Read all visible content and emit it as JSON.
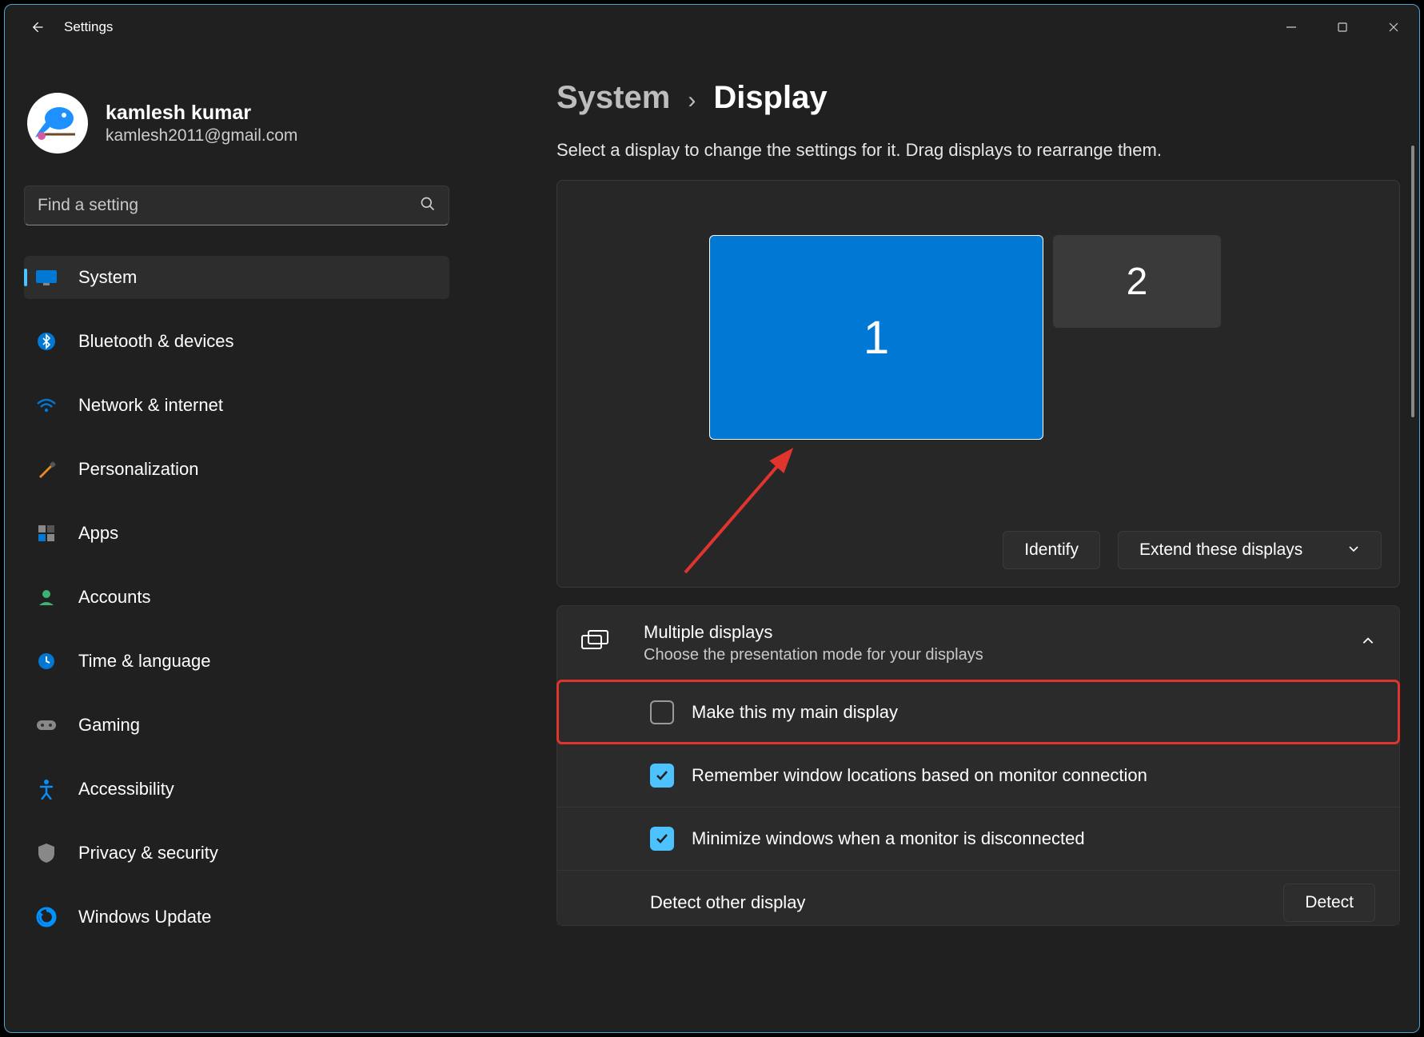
{
  "titlebar": {
    "app_name": "Settings"
  },
  "profile": {
    "name": "kamlesh kumar",
    "email": "kamlesh2011@gmail.com"
  },
  "search": {
    "placeholder": "Find a setting"
  },
  "nav": [
    {
      "label": "System",
      "active": true
    },
    {
      "label": "Bluetooth & devices"
    },
    {
      "label": "Network & internet"
    },
    {
      "label": "Personalization"
    },
    {
      "label": "Apps"
    },
    {
      "label": "Accounts"
    },
    {
      "label": "Time & language"
    },
    {
      "label": "Gaming"
    },
    {
      "label": "Accessibility"
    },
    {
      "label": "Privacy & security"
    },
    {
      "label": "Windows Update"
    }
  ],
  "breadcrumb": {
    "parent": "System",
    "current": "Display"
  },
  "hint": "Select a display to change the settings for it. Drag displays to rearrange them.",
  "displays": {
    "d1": "1",
    "d2": "2"
  },
  "arrangement_buttons": {
    "identify": "Identify",
    "mode": "Extend these displays"
  },
  "multi_panel": {
    "title": "Multiple displays",
    "subtitle": "Choose the presentation mode for your displays"
  },
  "options": {
    "main_display": "Make this my main display",
    "remember": "Remember window locations based on monitor connection",
    "minimize": "Minimize windows when a monitor is disconnected",
    "detect_label": "Detect other display",
    "detect_button": "Detect"
  }
}
